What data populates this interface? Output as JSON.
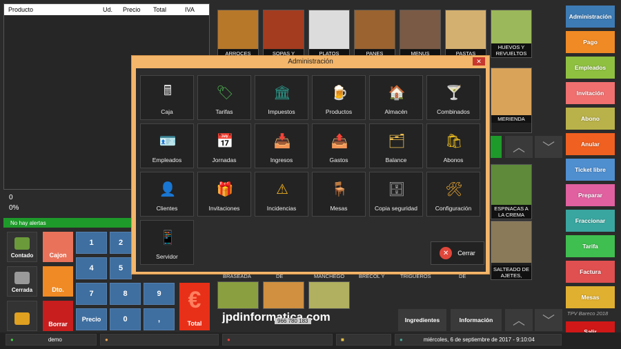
{
  "order_table": {
    "headers": [
      "Producto",
      "Ud.",
      "Precio",
      "Total",
      "IVA"
    ]
  },
  "totals": {
    "amount": "0",
    "percent": "0%"
  },
  "alerts": "No hay alertas",
  "side_buttons": [
    {
      "label": "Contado",
      "icon": "cash-icon"
    },
    {
      "label": "Cerrada",
      "icon": "cash-register-icon"
    },
    {
      "label": "",
      "icon": "table-icon"
    }
  ],
  "color_buttons": [
    {
      "label": "Cajon",
      "color": "#e8735a"
    },
    {
      "label": "Dto.",
      "color": "#f08a24"
    },
    {
      "label": "Borrar",
      "color": "#c81e1e"
    }
  ],
  "keypad": [
    "1",
    "2",
    "4",
    "5",
    "7",
    "8",
    "9",
    "Precio",
    "0",
    ","
  ],
  "total_button": "Total",
  "products_top": [
    {
      "label": "ARROCES",
      "color": "#b8782a"
    },
    {
      "label": "SOPAS Y",
      "color": "#a43c1f"
    },
    {
      "label": "PLATOS",
      "color": "#dcdcdc"
    },
    {
      "label": "PANES",
      "color": "#9a6330"
    },
    {
      "label": "MENUS",
      "color": "#7a5a45"
    },
    {
      "label": "PASTAS",
      "color": "#d4b070"
    },
    {
      "label": "HUEVOS Y REVUELTOS",
      "color": "#9bb85a"
    }
  ],
  "products_right": [
    {
      "label": "MERIENDA",
      "color": "#d9a35a"
    },
    {
      "label": "ESPINACAS A LA CREMA",
      "color": "#5e8a3a"
    },
    {
      "label": "SALTEADO DE AJETES,",
      "color": "#8a7a5a"
    }
  ],
  "products_bottom_labels": [
    "BRASEADA",
    "DE",
    "MANCHEGO",
    "BRECOL Y",
    "TRIGUEROS",
    "DE"
  ],
  "right_bar": [
    {
      "label": "Administración",
      "color": "#3d7bb5"
    },
    {
      "label": "Pago",
      "color": "#f08a24"
    },
    {
      "label": "Empleados",
      "color": "#8fc040"
    },
    {
      "label": "Invitación",
      "color": "#f07070"
    },
    {
      "label": "Abono",
      "color": "#b9b24a"
    },
    {
      "label": "Anular",
      "color": "#f06020"
    },
    {
      "label": "Ticket libre",
      "color": "#4f8fd0"
    },
    {
      "label": "Preparar",
      "color": "#e060a0"
    },
    {
      "label": "Fraccionar",
      "color": "#3aa6a0"
    },
    {
      "label": "Tarifa",
      "color": "#3fbf4f"
    },
    {
      "label": "Factura",
      "color": "#e05050"
    },
    {
      "label": "Mesas",
      "color": "#e0b030"
    },
    {
      "label": "Salir",
      "color": "#d01818"
    }
  ],
  "brand": {
    "name": "jpdinformatica.com",
    "phone": "966 780 183",
    "tpv": "TPV Bareco 2018"
  },
  "bottom_buttons": {
    "ingredients": "Ingredientes",
    "info": "Información"
  },
  "status_bar": {
    "user": "demo",
    "datetime": "miércoles, 6 de septiembre de 2017 - 9:10:04"
  },
  "modal": {
    "title": "Administración",
    "tiles": [
      {
        "label": "Caja",
        "icon": "cash-register-icon",
        "glyph": "🖩"
      },
      {
        "label": "Tarifas",
        "icon": "price-tag-icon",
        "glyph": "🏷"
      },
      {
        "label": "Impuestos",
        "icon": "bank-icon",
        "glyph": "🏛"
      },
      {
        "label": "Productos",
        "icon": "beer-mug-icon",
        "glyph": "🍺"
      },
      {
        "label": "Almacén",
        "icon": "house-icon",
        "glyph": "🏠"
      },
      {
        "label": "Combinados",
        "icon": "drinks-icon",
        "glyph": "🍸"
      },
      {
        "label": "Empleados",
        "icon": "id-card-icon",
        "glyph": "🪪"
      },
      {
        "label": "Jornadas",
        "icon": "calendar-clock-icon",
        "glyph": "📅"
      },
      {
        "label": "Ingresos",
        "icon": "inbox-in-icon",
        "glyph": "📥"
      },
      {
        "label": "Gastos",
        "icon": "inbox-out-icon",
        "glyph": "📤"
      },
      {
        "label": "Balance",
        "icon": "tray-icon",
        "glyph": "🗂"
      },
      {
        "label": "Abonos",
        "icon": "shopping-bag-icon",
        "glyph": "🛍"
      },
      {
        "label": "Clientes",
        "icon": "person-icon",
        "glyph": "👤"
      },
      {
        "label": "Invitaciones",
        "icon": "gift-icon",
        "glyph": "🎁"
      },
      {
        "label": "Incidencias",
        "icon": "warning-shield-icon",
        "glyph": "⚠"
      },
      {
        "label": "Mesas",
        "icon": "table-icon",
        "glyph": "🪑"
      },
      {
        "label": "Copia seguridad",
        "icon": "database-icon",
        "glyph": "🗄"
      },
      {
        "label": "Configuración",
        "icon": "tools-icon",
        "glyph": "🛠"
      },
      {
        "label": "Servidor",
        "icon": "tablet-icon",
        "glyph": "📱"
      }
    ],
    "close_label": "Cerrar"
  }
}
